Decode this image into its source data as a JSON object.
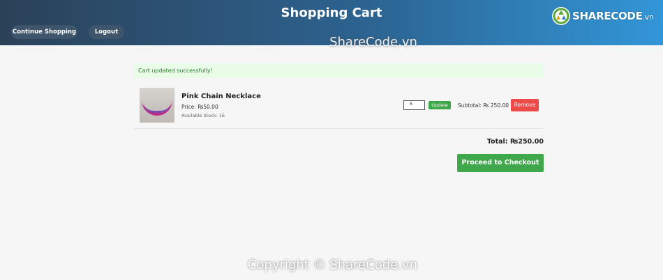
{
  "header": {
    "title": "Shopping Cart",
    "continue_label": "Continue Shopping",
    "logout_label": "Logout"
  },
  "logo": {
    "text_main": "SHARECODE",
    "text_suffix": ".vn"
  },
  "watermark": {
    "top": "ShareCode.vn",
    "bottom": "Copyright © ShareCode.vn"
  },
  "flash": {
    "message": "Cart updated successfully!"
  },
  "cart": {
    "items": [
      {
        "name": "Pink Chain Necklace",
        "price": "Price: ₨50.00",
        "stock": "Available Stock: 16",
        "quantity": "5",
        "update_label": "Update",
        "subtotal": "Subtotal: ₨ 250.00",
        "remove_label": "Remove"
      }
    ],
    "total": "Total: ₨250.00",
    "checkout_label": "Proceed to Checkout"
  },
  "colors": {
    "header_start": "#2b4158",
    "header_end": "#3296d8",
    "success_green": "#3fa84a",
    "danger_red": "#ef4a4a",
    "flash_bg": "#e8fce8"
  }
}
